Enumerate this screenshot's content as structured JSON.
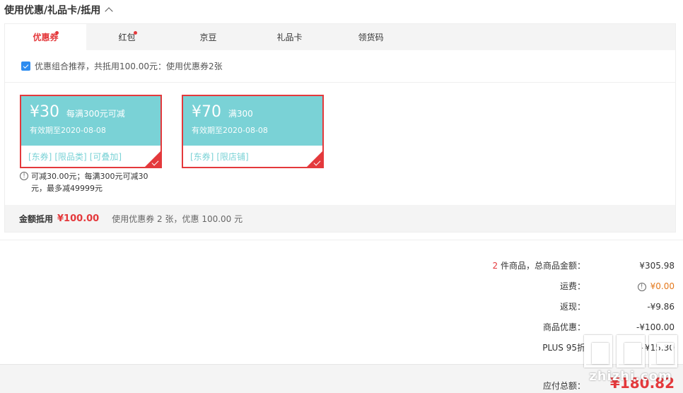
{
  "section": {
    "title": "使用优惠/礼品卡/抵用"
  },
  "tabs": [
    {
      "label": "优惠券",
      "active": true,
      "dot": true
    },
    {
      "label": "红包",
      "active": false,
      "dot": true
    },
    {
      "label": "京豆",
      "active": false,
      "dot": false
    },
    {
      "label": "礼品卡",
      "active": false,
      "dot": false
    },
    {
      "label": "领货码",
      "active": false,
      "dot": false
    }
  ],
  "recommend": {
    "text": "优惠组合推荐，共抵用100.00元：使用优惠券2张",
    "checked": true
  },
  "coupons": [
    {
      "amount": "¥30",
      "condition": "每满300元可减",
      "expiry": "有效期至2020-08-08",
      "tags": [
        "[东券]",
        "[限品类]",
        "[可叠加]"
      ],
      "selected": true,
      "note": "可减30.00元；每满300元可减30元，最多减49999元"
    },
    {
      "amount": "¥70",
      "condition": "满300",
      "expiry": "有效期至2020-08-08",
      "tags": [
        "[东券]",
        "[限店铺]"
      ],
      "selected": true,
      "note": ""
    }
  ],
  "summary": {
    "label": "金额抵用",
    "value": "¥100.00",
    "desc": "使用优惠券 2 张，优惠 100.00 元"
  },
  "totals": {
    "count": "2",
    "items_label": " 件商品，总商品金额：",
    "items_value": "¥305.98",
    "shipping_label": "运费：",
    "shipping_value": "¥0.00",
    "cashback_label": "返现：",
    "cashback_value": "-¥9.86",
    "discount_label": "商品优惠：",
    "discount_value": "-¥100.00",
    "plus_label": "PLUS 95折",
    "plus_value": "-¥15.30"
  },
  "payable": {
    "label": "应付总额：",
    "value": "¥180.82"
  },
  "watermark": {
    "text": "zhizhi.com"
  },
  "colors": {
    "accent": "#e4393c",
    "coupon": "#7ad2d6",
    "shipping": "#e4781b"
  }
}
